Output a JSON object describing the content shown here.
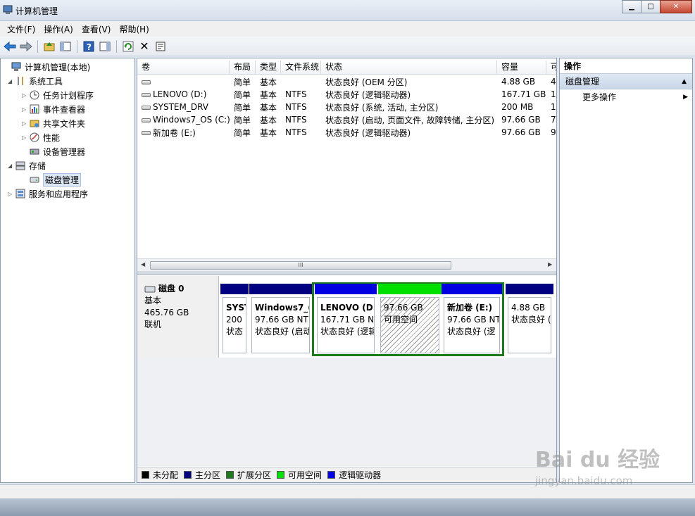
{
  "window": {
    "title": "计算机管理"
  },
  "menu": [
    "文件(F)",
    "操作(A)",
    "查看(V)",
    "帮助(H)"
  ],
  "tree": {
    "items": [
      {
        "label": "计算机管理(本地)",
        "level": 0,
        "expand": "",
        "icon": "computer-management-icon"
      },
      {
        "label": "系统工具",
        "level": 1,
        "expand": "open",
        "icon": "tools-icon"
      },
      {
        "label": "任务计划程序",
        "level": 2,
        "expand": "closed",
        "icon": "clock-icon"
      },
      {
        "label": "事件查看器",
        "level": 2,
        "expand": "closed",
        "icon": "event-viewer-icon"
      },
      {
        "label": "共享文件夹",
        "level": 2,
        "expand": "closed",
        "icon": "shared-folder-icon"
      },
      {
        "label": "性能",
        "level": 2,
        "expand": "closed",
        "icon": "performance-icon"
      },
      {
        "label": "设备管理器",
        "level": 2,
        "expand": "",
        "icon": "device-manager-icon"
      },
      {
        "label": "存储",
        "level": 1,
        "expand": "open",
        "icon": "storage-icon"
      },
      {
        "label": "磁盘管理",
        "level": 2,
        "expand": "",
        "icon": "disk-management-icon",
        "selected": true
      },
      {
        "label": "服务和应用程序",
        "level": 1,
        "expand": "closed",
        "icon": "services-icon"
      }
    ]
  },
  "volumes_table": {
    "headers": [
      "卷",
      "布局",
      "类型",
      "文件系统",
      "状态",
      "容量",
      "可"
    ],
    "rows": [
      {
        "volume": "",
        "layout": "简单",
        "type": "基本",
        "fs": "",
        "status": "状态良好 (OEM 分区)",
        "capacity": "4.88 GB",
        "free": "4"
      },
      {
        "volume": "LENOVO (D:)",
        "layout": "简单",
        "type": "基本",
        "fs": "NTFS",
        "status": "状态良好 (逻辑驱动器)",
        "capacity": "167.71 GB",
        "free": "1"
      },
      {
        "volume": "SYSTEM_DRV",
        "layout": "简单",
        "type": "基本",
        "fs": "NTFS",
        "status": "状态良好 (系统, 活动, 主分区)",
        "capacity": "200 MB",
        "free": "1"
      },
      {
        "volume": "Windows7_OS (C:)",
        "layout": "简单",
        "type": "基本",
        "fs": "NTFS",
        "status": "状态良好 (启动, 页面文件, 故障转储, 主分区)",
        "capacity": "97.66 GB",
        "free": "7"
      },
      {
        "volume": "新加卷 (E:)",
        "layout": "简单",
        "type": "基本",
        "fs": "NTFS",
        "status": "状态良好 (逻辑驱动器)",
        "capacity": "97.66 GB",
        "free": "9"
      }
    ],
    "scroll_thumb": "III"
  },
  "disk": {
    "name": "磁盘 0",
    "type": "基本",
    "size": "465.76 GB",
    "state": "联机",
    "partitions": [
      {
        "name": "SYST",
        "size": "200",
        "status": "状态",
        "kind": "primary"
      },
      {
        "name": "Windows7_(",
        "size": "97.66 GB NT",
        "status": "状态良好 (启动",
        "kind": "primary"
      },
      {
        "name": "LENOVO  (D",
        "size": "167.71 GB N",
        "status": "状态良好 (逻辑",
        "kind": "logical"
      },
      {
        "name": "",
        "size": "97.66 GB",
        "status": "可用空间",
        "kind": "free"
      },
      {
        "name": "新加卷  (E:)",
        "size": "97.66 GB NT",
        "status": "状态良好 (逻",
        "kind": "logical"
      },
      {
        "name": "",
        "size": "4.88 GB",
        "status": "状态良好 (",
        "kind": "primary"
      }
    ]
  },
  "legend": [
    {
      "label": "未分配",
      "color": "#000000"
    },
    {
      "label": "主分区",
      "color": "#000080"
    },
    {
      "label": "扩展分区",
      "color": "#1f7a1f"
    },
    {
      "label": "可用空间",
      "color": "#00e000"
    },
    {
      "label": "逻辑驱动器",
      "color": "#0000e0"
    }
  ],
  "actions": {
    "header": "操作",
    "section": "磁盘管理",
    "items": [
      "更多操作"
    ]
  },
  "watermark": {
    "brand": "Bai du 经验",
    "url": "jingyan.baidu.com"
  },
  "colors": {
    "primary": "#000080",
    "logical": "#0000e0",
    "free": "#00e000",
    "extended": "#1f7a1f"
  }
}
